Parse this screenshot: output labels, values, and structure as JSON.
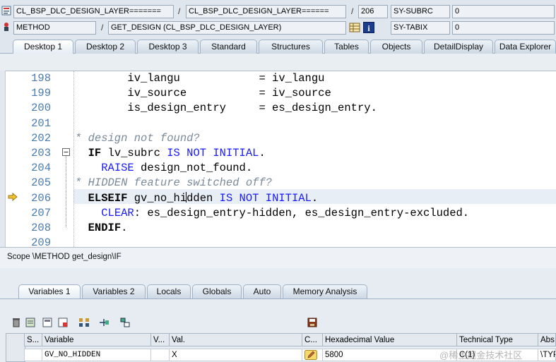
{
  "header": {
    "row1": {
      "program": "CL_BSP_DLC_DESIGN_LAYER=======",
      "include": "CL_BSP_DLC_DESIGN_LAYER======",
      "line": "206",
      "sysvar1_name": "SY-SUBRC",
      "sysvar1_value": "0"
    },
    "row2": {
      "event_type": "METHOD",
      "event_name": "GET_DESIGN (CL_BSP_DLC_DESIGN_LAYER)",
      "sysvar2_name": "SY-TABIX",
      "sysvar2_value": "0"
    }
  },
  "desktop_tabs": [
    "Desktop 1",
    "Desktop 2",
    "Desktop 3",
    "Standard",
    "Structures",
    "Tables",
    "Objects",
    "DetailDisplay",
    "Data Explorer"
  ],
  "code": {
    "lines": [
      {
        "num": "198",
        "parts": [
          {
            "t": "        iv_langu            = iv_langu",
            "c": "n"
          }
        ]
      },
      {
        "num": "199",
        "parts": [
          {
            "t": "        iv_source           = iv_source",
            "c": "n"
          }
        ]
      },
      {
        "num": "200",
        "parts": [
          {
            "t": "        is_design_entry     = es_design_entry.",
            "c": "n"
          }
        ]
      },
      {
        "num": "201",
        "parts": [
          {
            "t": "",
            "c": "n"
          }
        ]
      },
      {
        "num": "202",
        "parts": [
          {
            "t": "* design not found?",
            "c": "cm"
          }
        ]
      },
      {
        "num": "203",
        "parts": [
          {
            "t": "  ",
            "c": "n"
          },
          {
            "t": "IF",
            "c": "kwb"
          },
          {
            "t": " lv_subrc ",
            "c": "n"
          },
          {
            "t": "IS NOT INITIAL",
            "c": "kw"
          },
          {
            "t": ".",
            "c": "n"
          }
        ]
      },
      {
        "num": "204",
        "parts": [
          {
            "t": "    ",
            "c": "n"
          },
          {
            "t": "RAISE",
            "c": "kw"
          },
          {
            "t": " design_not_found.",
            "c": "n"
          }
        ]
      },
      {
        "num": "205",
        "parts": [
          {
            "t": "* HIDDEN feature switched off?",
            "c": "cm"
          }
        ]
      },
      {
        "num": "206",
        "parts": [
          {
            "t": "  ",
            "c": "n"
          },
          {
            "t": "ELSEIF",
            "c": "kwb"
          },
          {
            "t": " gv_no_hidden ",
            "c": "n"
          },
          {
            "t": "IS NOT INITIAL",
            "c": "kw"
          },
          {
            "t": ".",
            "c": "n"
          }
        ]
      },
      {
        "num": "207",
        "parts": [
          {
            "t": "    ",
            "c": "n"
          },
          {
            "t": "CLEAR",
            "c": "kw"
          },
          {
            "t": ": es_design_entry-hidden, es_design_entry-excluded.",
            "c": "n"
          }
        ]
      },
      {
        "num": "208",
        "parts": [
          {
            "t": "  ",
            "c": "n"
          },
          {
            "t": "ENDIF",
            "c": "kwb"
          },
          {
            "t": ".",
            "c": "n"
          }
        ]
      },
      {
        "num": "209",
        "parts": [
          {
            "t": "",
            "c": "n"
          }
        ]
      }
    ],
    "scope": "Scope \\METHOD get_design\\IF"
  },
  "var_tabs": [
    "Variables 1",
    "Variables 2",
    "Locals",
    "Globals",
    "Auto",
    "Memory Analysis"
  ],
  "grid": {
    "headers": {
      "s": "S...",
      "variable": "Variable",
      "v": "V...",
      "val": "Val.",
      "c": "C...",
      "hex": "Hexadecimal Value",
      "tech": "Technical Type",
      "abs": "Abs"
    },
    "row": {
      "variable": "GV_NO_HIDDEN",
      "val": "X",
      "hex": "5800",
      "tech": "C(1)",
      "abs": "\\TYP"
    }
  },
  "watermark": "@稀土掘金技术社区",
  "colors": {
    "keyword": "#1a1aff",
    "comment": "#7a8a99",
    "line_numbers": "#4a7bb0",
    "accent": "#e8a020"
  }
}
